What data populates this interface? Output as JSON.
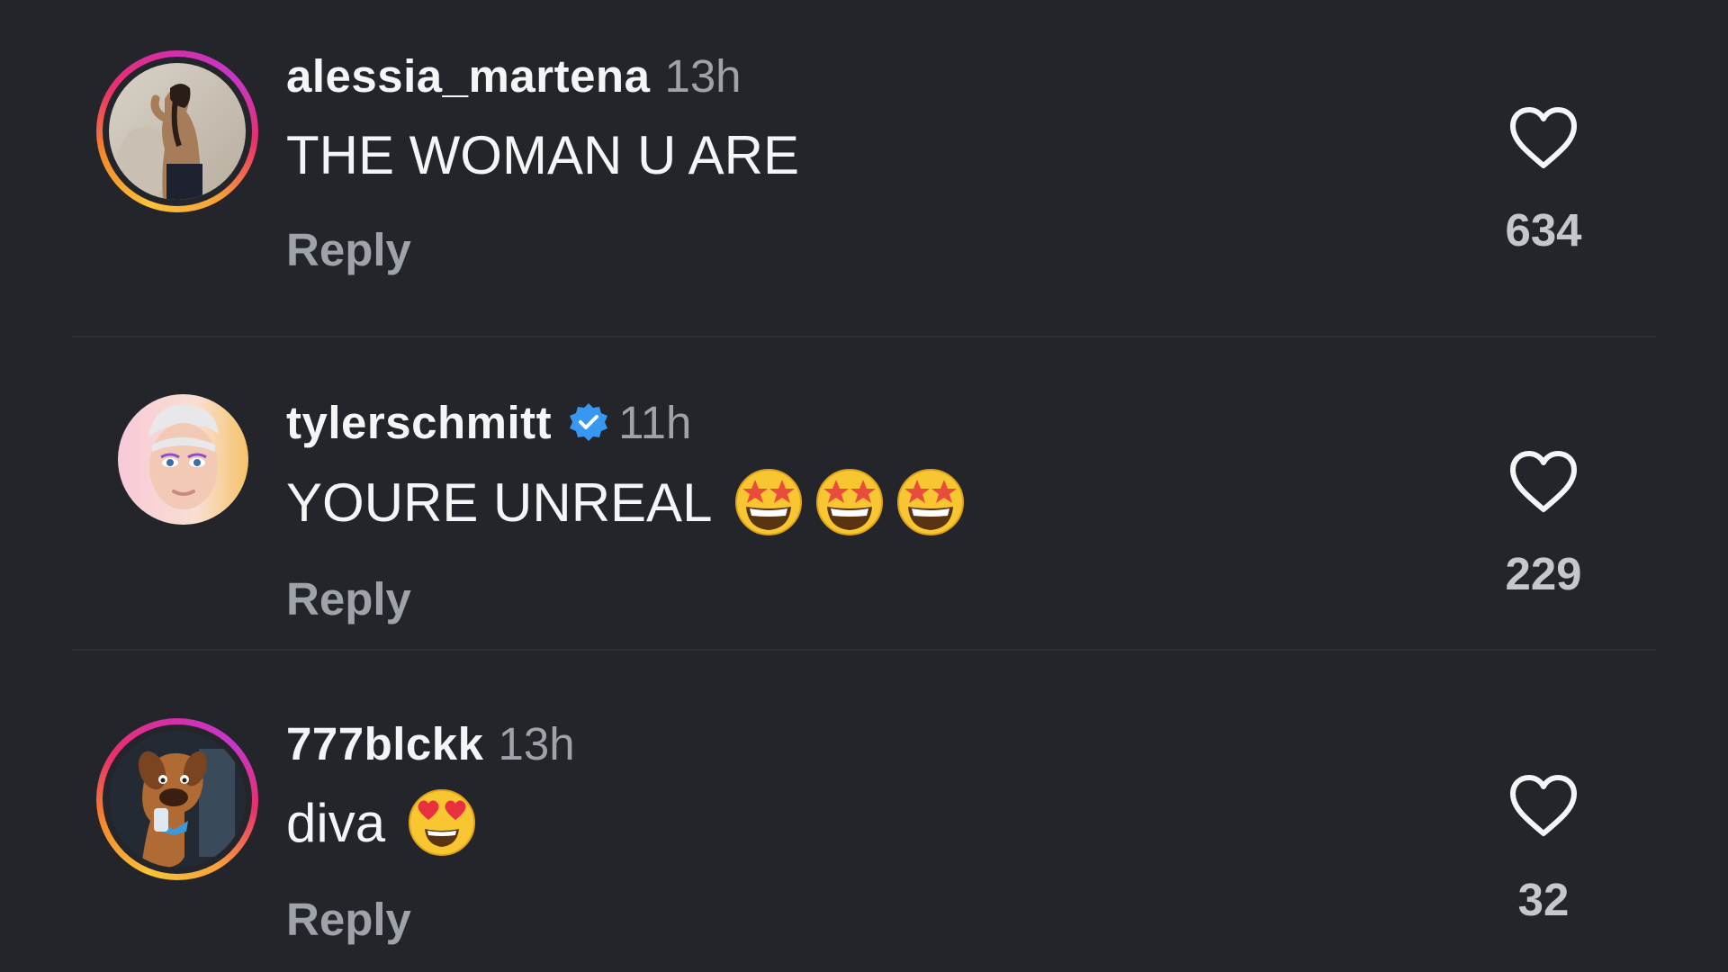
{
  "comments": [
    {
      "username": "alessia_martena",
      "time": "13h",
      "text": "THE WOMAN U ARE",
      "reply_label": "Reply",
      "likes": "634",
      "verified": false,
      "story_ring": true
    },
    {
      "username": "tylerschmitt",
      "time": "11h",
      "text": "YOURE UNREAL",
      "emojis": [
        "star-struck-emoji",
        "star-struck-emoji",
        "star-struck-emoji"
      ],
      "reply_label": "Reply",
      "likes": "229",
      "verified": true,
      "story_ring": false
    },
    {
      "username": "777blckk",
      "time": "13h",
      "text": "diva",
      "emojis": [
        "heart-eyes-emoji"
      ],
      "reply_label": "Reply",
      "likes": "32",
      "verified": false,
      "story_ring": true
    }
  ],
  "icons": {
    "like": "heart-outline-icon",
    "verified": "verified-badge-icon"
  },
  "colors": {
    "background": "#23252b",
    "primary_text": "#f4f5f7",
    "secondary_text": "#9ea2a9",
    "verified_blue": "#3897f0"
  }
}
